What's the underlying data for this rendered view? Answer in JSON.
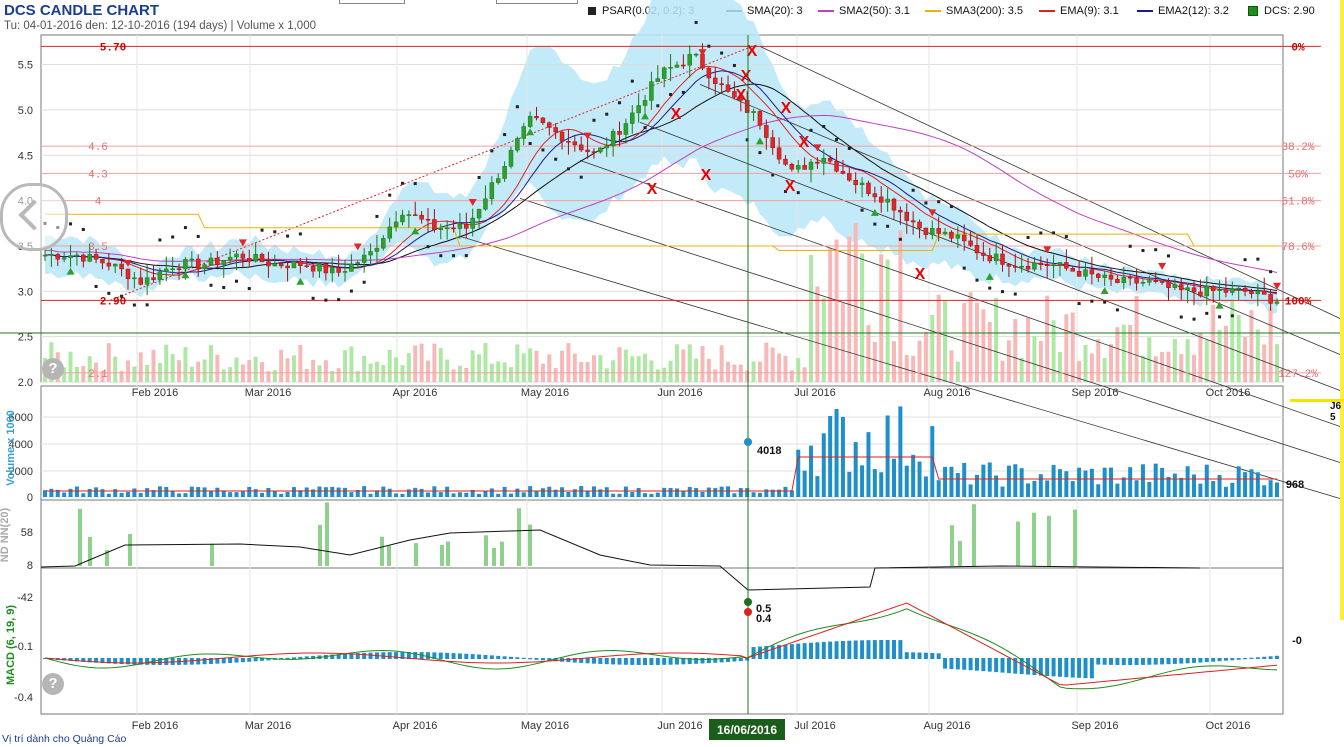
{
  "header": {
    "title": "DCS CANDLE CHART",
    "subtitle": "Tu: 04-01-2016 den: 12-10-2016 (194 days) | Volume x 1,000"
  },
  "legend": [
    {
      "name": "PSAR(0.02, 0.2): 3",
      "color": "#222222",
      "kind": "square"
    },
    {
      "name": "SMA(20): 3",
      "color": "#111111",
      "kind": "line"
    },
    {
      "name": "SMA2(50): 3.1",
      "color": "#c040c0",
      "kind": "line"
    },
    {
      "name": "SMA3(200): 3.5",
      "color": "#e8b400",
      "kind": "line"
    },
    {
      "name": "EMA(9): 3.1",
      "color": "#e02020",
      "kind": "line"
    },
    {
      "name": "EMA2(12): 3.2",
      "color": "#1a1a90",
      "kind": "line"
    },
    {
      "name": "DCS: 2.90",
      "color": "#1e8c1e",
      "kind": "box"
    }
  ],
  "footer": "Vị trí dành cho Quảng Cáo",
  "crosshair": {
    "label": "16/06/2016",
    "volume_value": "4018",
    "macd_value": "0.5",
    "signal_value": "0.4"
  },
  "side": {
    "volume_last": "968",
    "macd_zero": "-0",
    "yellow_text_1": "J6",
    "yellow_text_2": "5"
  },
  "chart_data": [
    {
      "type": "candlestick",
      "title": "DCS CANDLE CHART",
      "ylim": [
        2.0,
        5.8
      ],
      "y_ticks": [
        "2.0",
        "2.5",
        "3.0",
        "3.5",
        "4.0",
        "4.5",
        "5.0",
        "5.5"
      ],
      "x_ticks": [
        "Feb 2016",
        "Mar 2016",
        "Apr 2016",
        "May 2016",
        "Jun 2016",
        "Jul 2016",
        "Aug 2016",
        "Sep 2016",
        "Oct 2016"
      ],
      "fib_levels": [
        {
          "price_label": "5.70",
          "pct": "0%",
          "value": 5.7
        },
        {
          "price_label": "4.6",
          "pct": "38.2%",
          "value": 4.6
        },
        {
          "price_label": "4.3",
          "pct": "50%",
          "value": 4.3
        },
        {
          "price_label": "4",
          "pct": "61.8%",
          "value": 4.0
        },
        {
          "price_label": "3.5",
          "pct": "78.6%",
          "value": 3.5
        },
        {
          "price_label": "2.90",
          "pct": "100%",
          "value": 2.9
        },
        {
          "price_label": "2.1",
          "pct": "127.2%",
          "value": 2.1
        }
      ],
      "close_approx": [
        3.4,
        3.4,
        3.3,
        3.1,
        3.3,
        3.3,
        3.4,
        3.3,
        3.3,
        3.2,
        3.4,
        3.9,
        3.7,
        3.7,
        4.3,
        4.9,
        4.7,
        4.5,
        4.9,
        5.4,
        5.6,
        5.2,
        4.9,
        4.3,
        4.5,
        4.2,
        4.0,
        3.7,
        3.6,
        3.4,
        3.3,
        3.3,
        3.2,
        3.1,
        3.1,
        3.0,
        3.0,
        3.0,
        2.9
      ],
      "last_close": 2.9
    },
    {
      "type": "bar",
      "ylabel": "Volume x 1000",
      "y_ticks": [
        "0",
        "2000",
        "4000",
        "6000"
      ],
      "annotated": {
        "date": "16/06/2016",
        "value": 4018
      },
      "last": 968
    },
    {
      "type": "line",
      "ylabel": "ND NN(20)",
      "y_ticks": [
        "8",
        "58"
      ]
    },
    {
      "type": "line",
      "ylabel": "MACD (6, 19, 9)",
      "y_ticks": [
        "-0.4",
        "-0.1",
        "-42"
      ],
      "annotated": {
        "macd": 0.5,
        "signal": 0.4
      }
    }
  ]
}
